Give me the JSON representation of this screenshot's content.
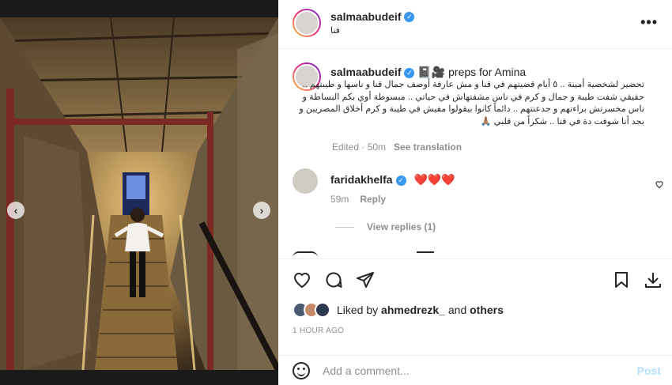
{
  "post": {
    "username": "salmaabudeif",
    "location": "قنا",
    "more_label": "•••"
  },
  "caption": {
    "username": "salmaabudeif",
    "title_suffix": "📓🎥 preps for Amina",
    "body": "تحضير لشخصية أمينة .. ٥ أيام قضيتهم في قنا و مش عارفة أوصف جمال قنا و ناسها و طيبتهم .. حقيقي شفت طيبة و جمال و كرم في ناس مشفتهاش في حياتي .. مبسوطة أوي بكم البساطة و ناس مخسرتش براءتهم و جدعنتهم .. دائماً كانوا بيقولوا مفيش في طيبة و كرم أخلاق المصريين و بجد أنا شوفت دة في قنا .. شكراً من قلبي 🙏🏽",
    "edited": "Edited · 50m",
    "see_translation": "See translation"
  },
  "comment": {
    "username": "faridakhelfa",
    "text": "❤️❤️❤️",
    "age": "59m",
    "reply_label": "Reply",
    "view_replies": "View replies (1)"
  },
  "likes": {
    "prefix": "Liked by",
    "user": "ahmedrezk_",
    "connector": "and",
    "others": "others"
  },
  "timestamp": "1 HOUR AGO",
  "add_comment": {
    "placeholder": "Add a comment...",
    "post_label": "Post"
  },
  "media": {
    "prev_icon": "‹",
    "next_icon": "›",
    "slide_count": 3,
    "active_slide": 2
  },
  "colors": {
    "accent_blue": "#3897f0",
    "post_disabled": "#b2dffc",
    "muted": "#8e8e8e"
  }
}
